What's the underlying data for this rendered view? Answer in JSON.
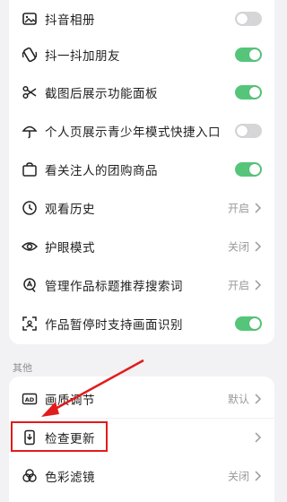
{
  "settings_top": [
    {
      "label": "抖音相册",
      "icon": "album-icon",
      "control": "toggle",
      "on": false
    },
    {
      "label": "抖一抖加朋友",
      "icon": "shake-phone-icon",
      "control": "toggle",
      "on": true
    },
    {
      "label": "截图后展示功能面板",
      "icon": "scissors-icon",
      "control": "toggle",
      "on": true
    },
    {
      "label": "个人页展示青少年模式快捷入口",
      "icon": "umbrella-icon",
      "control": "toggle",
      "on": false
    },
    {
      "label": "看关注人的团购商品",
      "icon": "shopping-icon",
      "control": "toggle",
      "on": true
    },
    {
      "label": "观看历史",
      "icon": "clock-icon",
      "control": "value",
      "value": "开启"
    },
    {
      "label": "护眼模式",
      "icon": "eye-icon",
      "control": "value",
      "value": "关闭"
    },
    {
      "label": "管理作品标题推荐搜索词",
      "icon": "search-tag-icon",
      "control": "value",
      "value": "开启"
    },
    {
      "label": "作品暂停时支持画面识别",
      "icon": "scan-icon",
      "control": "toggle",
      "on": true
    }
  ],
  "section_other": "其他",
  "settings_bottom": [
    {
      "label": "画质调节",
      "icon": "ad-quality-icon",
      "control": "value",
      "value": "默认"
    },
    {
      "label": "检查更新",
      "icon": "update-icon",
      "control": "chevron"
    },
    {
      "label": "色彩滤镜",
      "icon": "color-filter-icon",
      "control": "value",
      "value": "关闭"
    }
  ],
  "colors": {
    "toggle_on": "#55c57a",
    "toggle_off": "#d6d6d9",
    "annotation": "#e21b1b"
  }
}
